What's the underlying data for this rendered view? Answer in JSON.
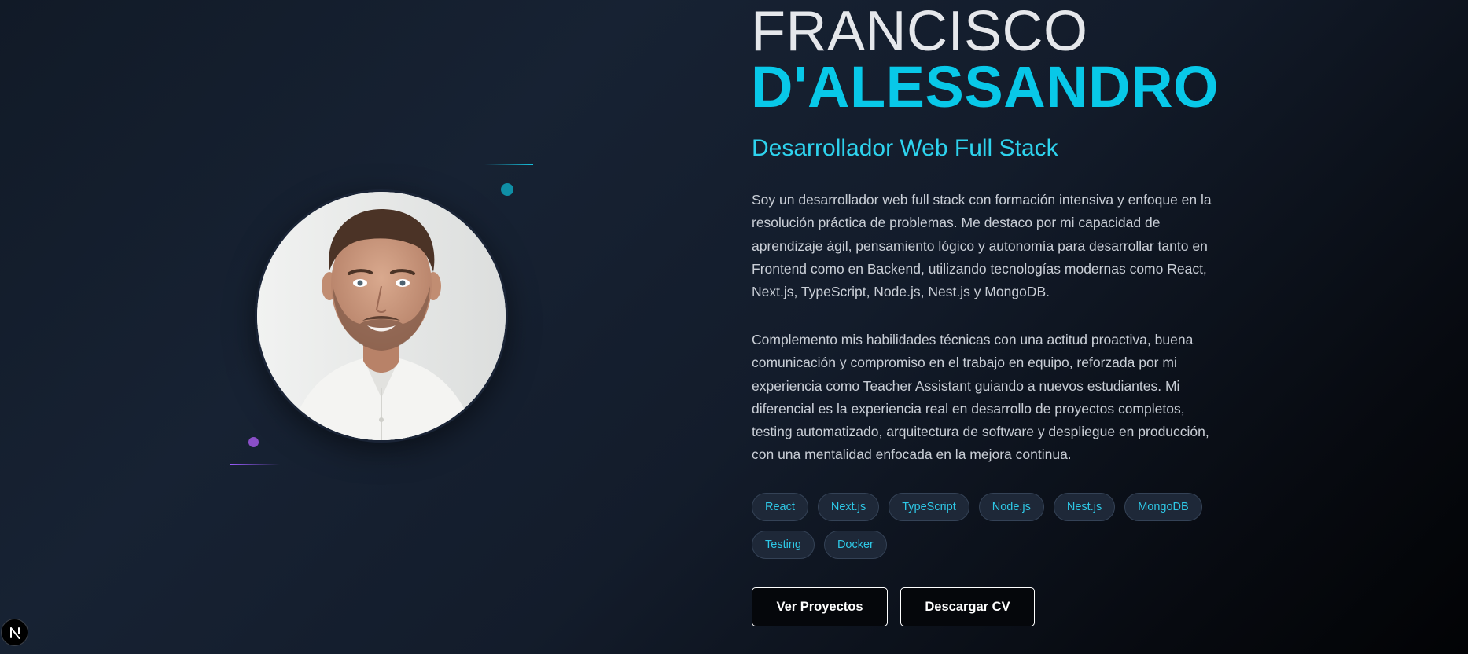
{
  "hero": {
    "first_name": "FRANCISCO",
    "last_name": "D'ALESSANDRO",
    "role": "Desarrollador Web Full Stack",
    "bio": [
      "Soy un desarrollador web full stack con formación intensiva y enfoque en la resolución práctica de problemas. Me destaco por mi capacidad de aprendizaje ágil, pensamiento lógico y autonomía para desarrollar tanto en Frontend como en Backend, utilizando tecnologías modernas como React, Next.js, TypeScript, Node.js, Nest.js y MongoDB.",
      "Complemento mis habilidades técnicas con una actitud proactiva, buena comunicación y compromiso en el trabajo en equipo, reforzada por mi experiencia como Teacher Assistant guiando a nuevos estudiantes. Mi diferencial es la experiencia real en desarrollo de proyectos completos, testing automatizado, arquitectura de software y despliegue en producción, con una mentalidad enfocada en la mejora continua."
    ],
    "tags": [
      "React",
      "Next.js",
      "TypeScript",
      "Node.js",
      "Nest.js",
      "MongoDB",
      "Testing",
      "Docker"
    ],
    "buttons": {
      "projects_label": "Ver Proyectos",
      "cv_label": "Descargar CV"
    }
  },
  "profile_photo": {
    "icon": "profile-photo"
  },
  "dev_indicator": {
    "label": "N",
    "icon": "nextjs-icon"
  },
  "colors": {
    "accent": "#08c8e8",
    "accent_soft": "#2ed3ee",
    "purple": "#8a4fc7",
    "background": "#131c2b"
  }
}
